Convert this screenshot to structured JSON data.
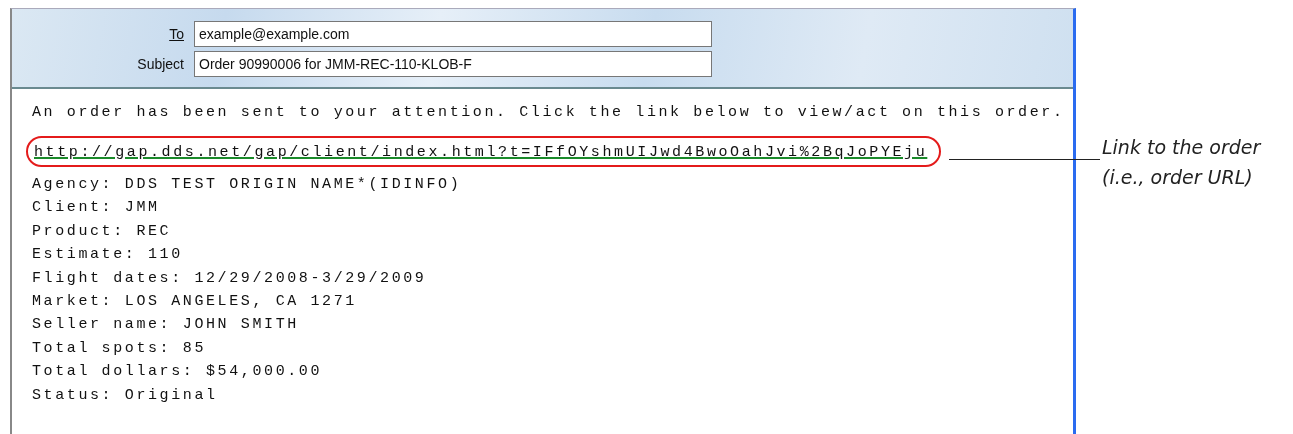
{
  "email": {
    "to_label": "To",
    "to": "example@example.com",
    "subject_label": "Subject",
    "subject": "Order 90990006 for JMM-REC-110-KLOB-F",
    "intro": "An order has been sent to your attention. Click the link below to view/act on this order.",
    "link": "http://gap.dds.net/gap/client/index.html?t=IFfOYshmUIJwd4BwoOahJvi%2BqJoPYEju",
    "details": [
      "Agency: DDS TEST ORIGIN NAME*(IDINFO)",
      "Client: JMM",
      "Product: REC",
      "Estimate: 110",
      "Flight dates: 12/29/2008-3/29/2009",
      "Market: LOS ANGELES, CA 1271",
      "Seller name: JOHN SMITH",
      "Total spots: 85",
      "Total dollars: $54,000.00",
      "Status: Original"
    ]
  },
  "callout": {
    "text": "Link to the order (i.e., order URL)"
  }
}
